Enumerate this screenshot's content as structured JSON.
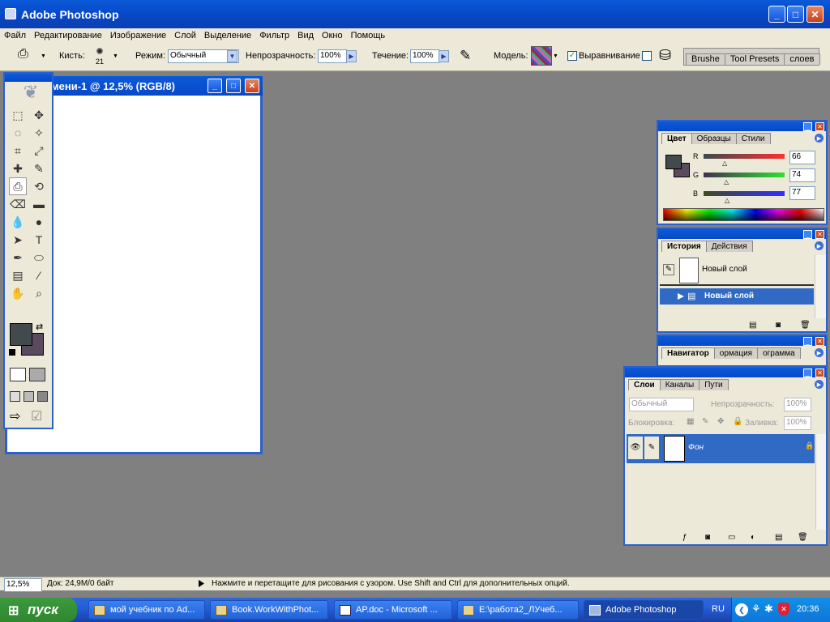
{
  "window": {
    "title": "Adobe Photoshop",
    "min": "_",
    "max": "□",
    "close": "✕"
  },
  "menu": [
    "Файл",
    "Редактирование",
    "Изображение",
    "Слой",
    "Выделение",
    "Фильтр",
    "Вид",
    "Окно",
    "Помощь"
  ],
  "options": {
    "brush_label": "Кисть:",
    "brush_size": "21",
    "mode_label": "Режим:",
    "mode_value": "Обычный",
    "opacity_label": "Непрозрачность:",
    "opacity_value": "100%",
    "flow_label": "Течение:",
    "flow_value": "100%",
    "model_label": "Модель:",
    "align_label": "Выравнивание",
    "palette_tabs": [
      "Brushe",
      "Tool Presets",
      "слоев"
    ]
  },
  "document": {
    "title": "мени-1 @ 12,5% (RGB/8)"
  },
  "color_panel": {
    "tabs": [
      "Цвет",
      "Образцы",
      "Стили"
    ],
    "channels": [
      {
        "label": "R",
        "value": "66",
        "color": "#d03030"
      },
      {
        "label": "G",
        "value": "74",
        "color": "#30c030"
      },
      {
        "label": "B",
        "value": "77",
        "color": "#3030d0"
      }
    ],
    "foreground": "#424a4d",
    "background": "#5a4a5e"
  },
  "history_panel": {
    "tabs": [
      "История",
      "Действия"
    ],
    "snapshot_label": "Новый слой",
    "step_label": "Новый слой"
  },
  "navigator_panel": {
    "tabs": [
      "Навигатор",
      "ормация",
      "ограмма"
    ]
  },
  "layers_panel": {
    "tabs": [
      "Слои",
      "Каналы",
      "Пути"
    ],
    "blend_mode": "Обычный",
    "opacity_label": "Непрозрачность:",
    "opacity_value": "100%",
    "lock_label": "Блокировка:",
    "fill_label": "Заливка:",
    "fill_value": "100%",
    "layer_name": "Фон"
  },
  "status": {
    "zoom": "12,5%",
    "doc_info": "Док: 24,9M/0 байт",
    "hint": "Нажмите и перетащите для рисования с узором.  Use Shift and Ctrl для дополнительных опций."
  },
  "taskbar": {
    "start": "пуск",
    "tasks": [
      "мой учебник по Ad...",
      "Book.WorkWithPhot...",
      "AP.doc - Microsoft ...",
      "E:\\работа2_ЛУчеб...",
      "Adobe Photoshop"
    ],
    "lang": "RU",
    "clock": "20:36"
  },
  "colors": {
    "accent": "#2a61cf",
    "workspace": "#808080",
    "chrome": "#ece9d8",
    "selection": "#316ac5"
  }
}
